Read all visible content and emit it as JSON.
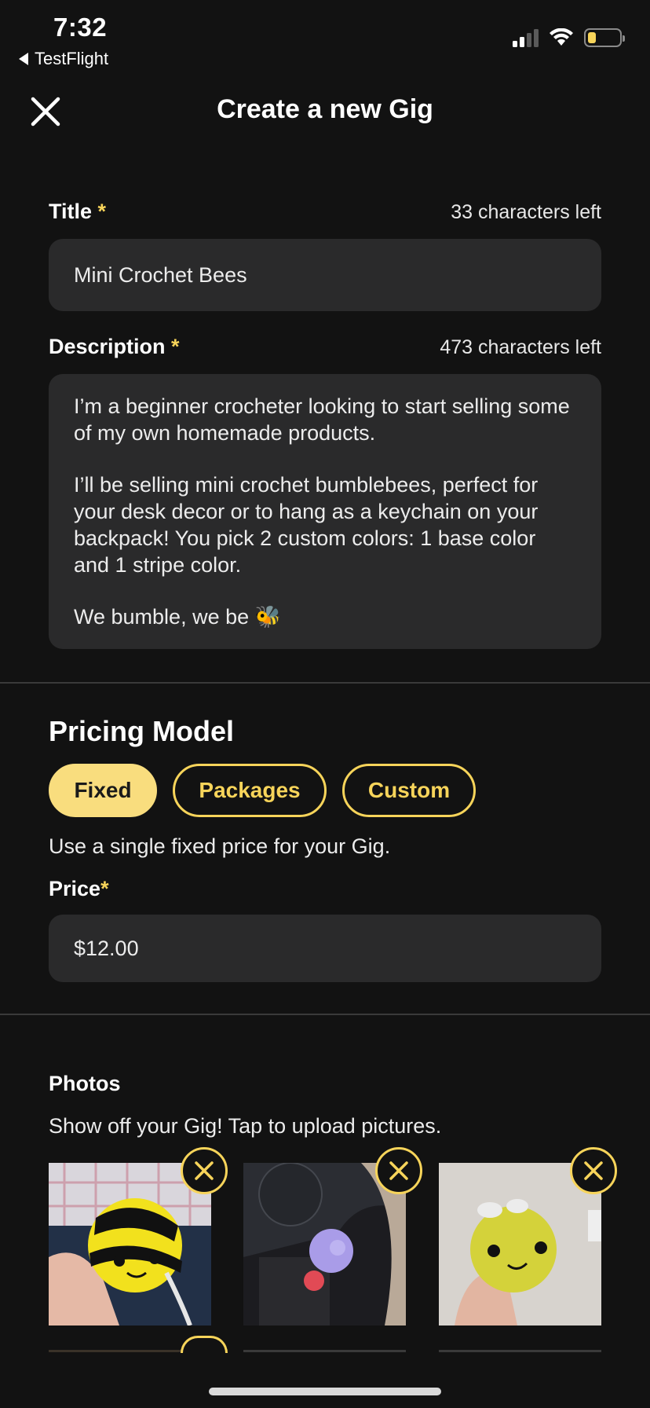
{
  "status_bar": {
    "time": "7:32",
    "back_app": "TestFlight"
  },
  "header": {
    "title": "Create a new Gig"
  },
  "title_field": {
    "label": "Title",
    "required_mark": "*",
    "counter": "33 characters left",
    "value": "Mini Crochet Bees"
  },
  "description_field": {
    "label": "Description",
    "required_mark": "*",
    "counter": "473 characters left",
    "paragraphs": [
      "I’m a beginner crocheter looking to start selling some of my own homemade products.",
      "I’ll be selling mini crochet bumblebees, perfect for your desk decor or to hang as a keychain on your backpack! You pick 2 custom colors: 1 base color and 1 stripe color.",
      "We bumble, we be 🐝"
    ]
  },
  "pricing": {
    "title": "Pricing Model",
    "options": [
      "Fixed",
      "Packages",
      "Custom"
    ],
    "selected": "Fixed",
    "helper": "Use a single fixed price for your Gig.",
    "price_label": "Price",
    "required_mark": "*",
    "price_value": "$12.00"
  },
  "photos": {
    "title": "Photos",
    "helper": "Show off your Gig! Tap to upload pictures.",
    "items": [
      {
        "icon": "remove-icon",
        "alt": "bee-photo-1"
      },
      {
        "icon": "remove-icon",
        "alt": "bee-photo-2"
      },
      {
        "icon": "remove-icon",
        "alt": "bee-photo-3"
      }
    ]
  },
  "colors": {
    "background": "#121212",
    "field": "#2a2a2b",
    "accent": "#f7d45a",
    "accent_fill": "#f9dd7e"
  }
}
